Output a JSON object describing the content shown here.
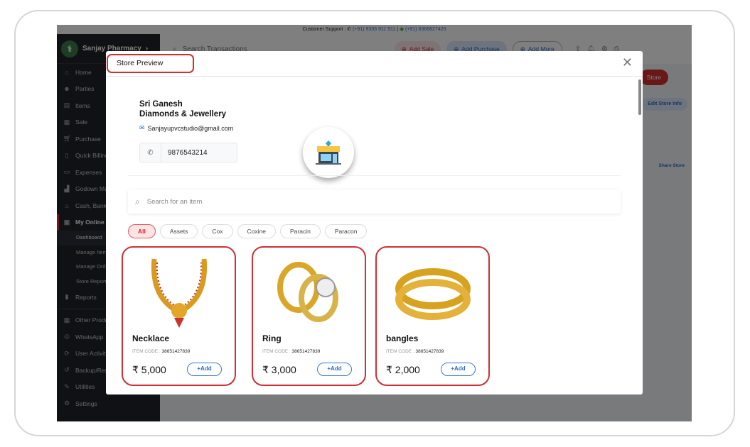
{
  "support": {
    "label": "Customer Support :",
    "phone1": "(+91) 9333 911 911",
    "phone2": "(+91) 6366827420"
  },
  "sidebar": {
    "brand": "Sanjay Pharmacy",
    "items": [
      {
        "label": "Home",
        "icon": "home-icon"
      },
      {
        "label": "Parties",
        "icon": "users-icon"
      },
      {
        "label": "Items",
        "icon": "items-icon"
      },
      {
        "label": "Sale",
        "icon": "sale-icon"
      },
      {
        "label": "Purchase",
        "icon": "cart-icon"
      },
      {
        "label": "Quick Billing",
        "icon": "billing-icon"
      },
      {
        "label": "Expenses",
        "icon": "wallet-icon"
      },
      {
        "label": "Godown Management",
        "icon": "godown-icon"
      },
      {
        "label": "Cash, Bank",
        "icon": "bank-icon"
      },
      {
        "label": "My Online Store",
        "icon": "store-icon"
      }
    ],
    "sub": [
      "Dashboard",
      "Manage Items",
      "Manage Orders",
      "Store Reports"
    ],
    "items2": [
      {
        "label": "Reports"
      },
      {
        "label": "Other Products"
      },
      {
        "label": "WhatsApp"
      },
      {
        "label": "User Activity"
      },
      {
        "label": "Backup/Restore"
      },
      {
        "label": "Utilities"
      },
      {
        "label": "Settings"
      }
    ]
  },
  "topbar": {
    "search_placeholder": "Search Transactions",
    "add_sale": "Add Sale",
    "add_purchase": "Add Purchase",
    "add_more": "Add More"
  },
  "background": {
    "store_btn": "Store",
    "edit_store": "Edit Store Info",
    "share_store": "Share Store"
  },
  "modal": {
    "title": "Store Preview",
    "store": {
      "name_line1": "Sri Ganesh",
      "name_line2": "Diamonds & Jewellery",
      "email": "Sanjayupvcstudio@gmail.com",
      "phone": "9876543214"
    },
    "search_placeholder": "Search for an item",
    "categories": [
      "All",
      "Assets",
      "Cox",
      "Coxine",
      "Paracin",
      "Paracon"
    ],
    "code_label": "ITEM CODE :",
    "add_label": "+Add",
    "products": [
      {
        "name": "Necklace",
        "code": "38651427839",
        "price": "₹ 5,000"
      },
      {
        "name": "Ring",
        "code": "38651427839",
        "price": "₹ 3,000"
      },
      {
        "name": "bangles",
        "code": "38651427839",
        "price": "₹ 2,000"
      }
    ]
  },
  "colors": {
    "accent": "#d32f2f",
    "link": "#2e6bc0"
  }
}
